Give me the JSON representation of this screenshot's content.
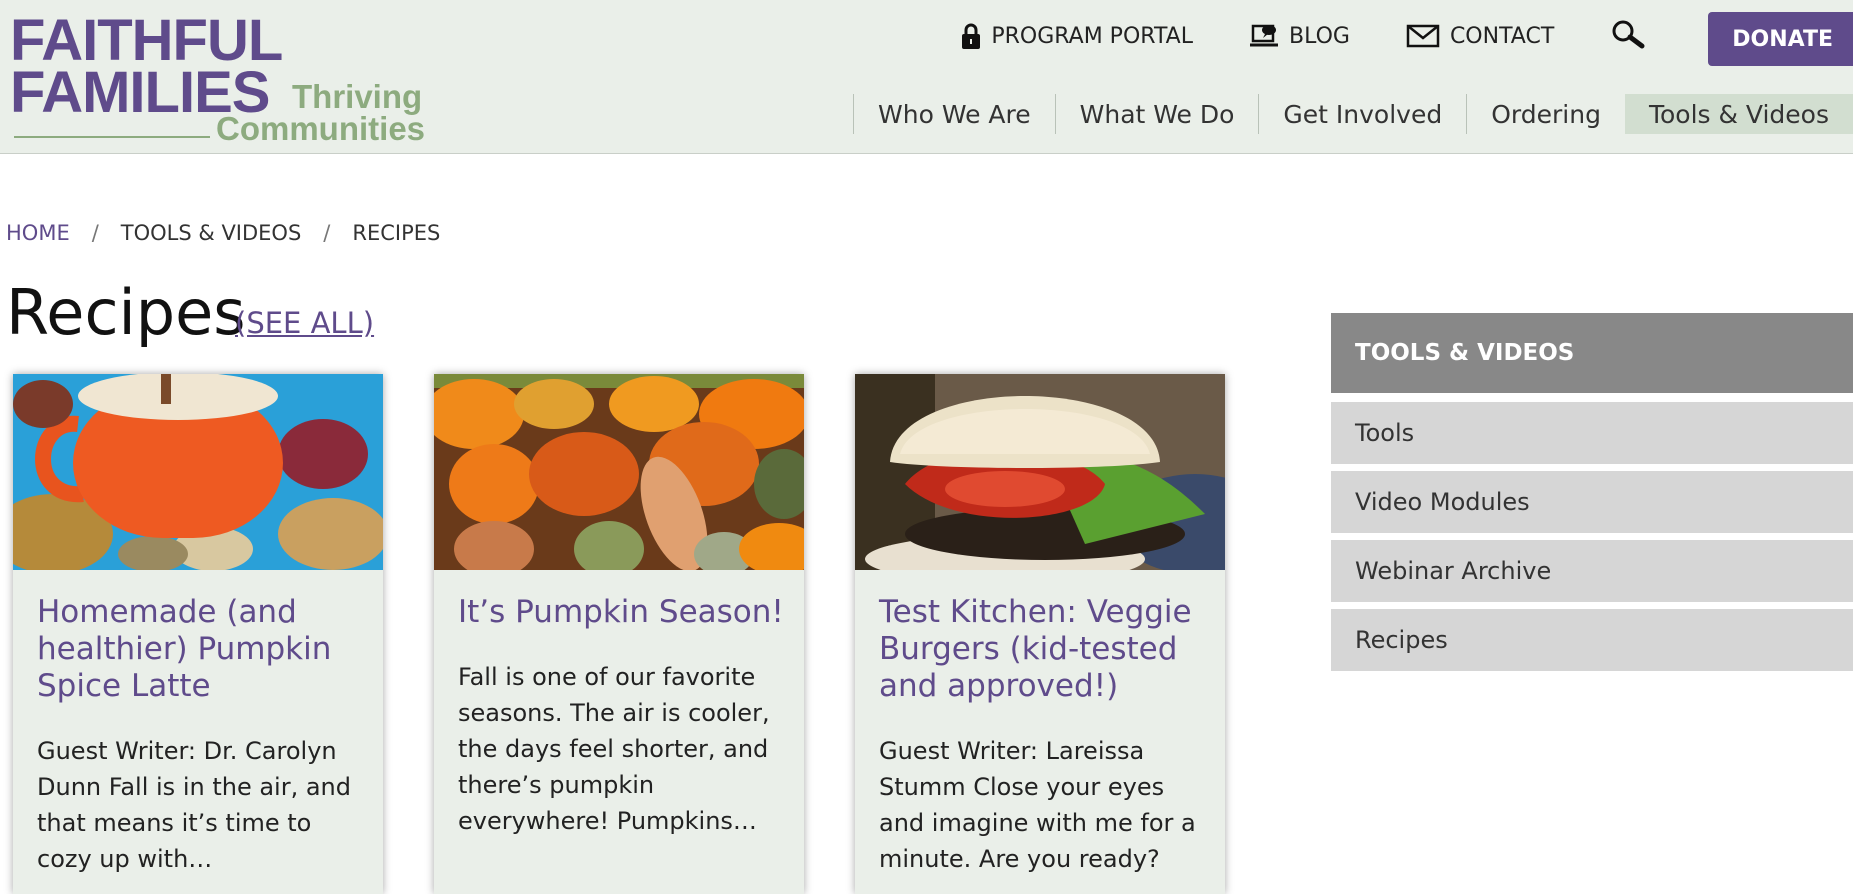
{
  "logo": {
    "line1": "FAITHFUL",
    "line2": "FAMILIES",
    "tag1": "Thriving",
    "tag2": "Communities"
  },
  "utility_nav": {
    "program_portal": "PROGRAM PORTAL",
    "blog": "BLOG",
    "contact": "CONTACT",
    "donate": "DONATE"
  },
  "main_nav": {
    "items": [
      {
        "label": "Who We Are"
      },
      {
        "label": "What We Do"
      },
      {
        "label": "Get Involved"
      },
      {
        "label": "Ordering"
      },
      {
        "label": "Tools & Videos"
      }
    ]
  },
  "breadcrumb": {
    "home": "HOME",
    "sep": "/",
    "level1": "TOOLS & VIDEOS",
    "level2": "RECIPES"
  },
  "page": {
    "title": "Recipes",
    "see_all": "(SEE ALL)"
  },
  "cards": [
    {
      "title": "Homemade (and healthier) Pumpkin Spice Latte",
      "excerpt": "  Guest Writer: Dr. Carolyn Dunn Fall is in the air, and that means it’s time to cozy up with…"
    },
    {
      "title": "It’s Pumpkin Season!",
      "excerpt": "Fall is one of our favorite seasons. The air is cooler, the days feel shorter, and there’s pumpkin everywhere! Pumpkins…"
    },
    {
      "title": "Test Kitchen: Veggie Burgers (kid-tested and approved!)",
      "excerpt": "  Guest Writer: Lareissa Stumm   Close your eyes and imagine with me for a minute. Are you ready?"
    }
  ],
  "sidebar": {
    "heading": "TOOLS & VIDEOS",
    "items": [
      {
        "label": "Tools"
      },
      {
        "label": "Video Modules"
      },
      {
        "label": "Webinar Archive"
      },
      {
        "label": "Recipes"
      }
    ]
  },
  "colors": {
    "brand_purple": "#5f4b8b",
    "brand_green": "#8dab7f",
    "header_bg": "#eaefe9"
  }
}
